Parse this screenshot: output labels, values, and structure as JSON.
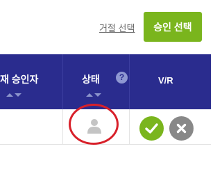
{
  "toolbar": {
    "reject_selection_label": "거절 선택",
    "approve_selection_label": "승인 선택"
  },
  "table": {
    "columns": {
      "current_approver": "재 승인자",
      "status": "상태",
      "vr": "V/R"
    },
    "help_symbol": "?"
  },
  "row": {
    "status_icon": "user-icon",
    "actions": [
      "check-icon",
      "x-icon"
    ]
  },
  "colors": {
    "header_bg": "#2a2c8e",
    "approve_green": "#7ab51d",
    "reject_gray": "#888888",
    "highlight_red": "#d8202a"
  }
}
